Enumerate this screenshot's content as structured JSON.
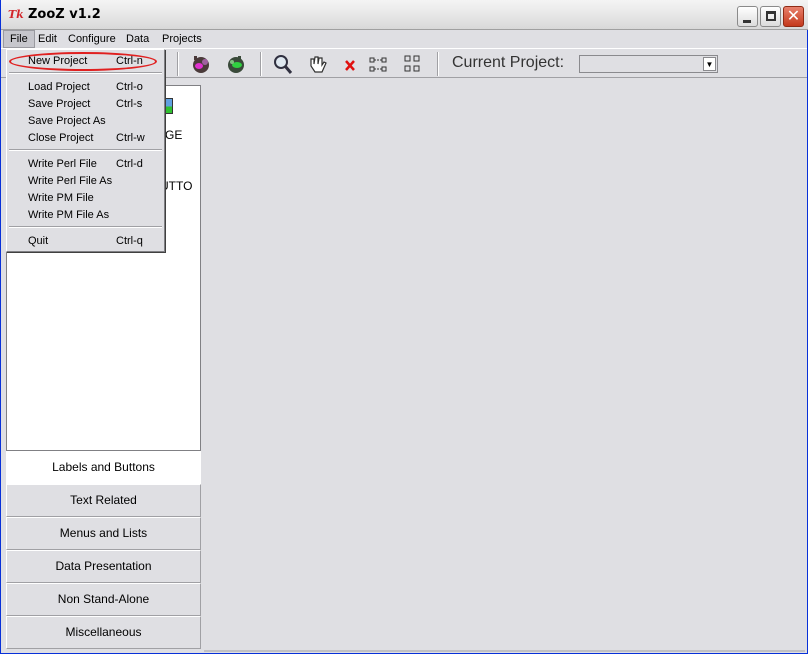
{
  "window": {
    "title": "ZooZ v1.2"
  },
  "menubar": {
    "items": [
      {
        "label": "File"
      },
      {
        "label": "Edit"
      },
      {
        "label": "Configure"
      },
      {
        "label": "Data"
      },
      {
        "label": "Projects"
      }
    ]
  },
  "toolbar": {
    "current_project_label": "Current Project:",
    "current_project_value": ""
  },
  "file_menu": {
    "items": [
      {
        "label": "New Project",
        "accel": "Ctrl-n"
      },
      {
        "label": "Load Project",
        "accel": "Ctrl-o"
      },
      {
        "label": "Save Project",
        "accel": "Ctrl-s"
      },
      {
        "label": "Save Project As",
        "accel": ""
      },
      {
        "label": "Close Project",
        "accel": "Ctrl-w"
      },
      {
        "label": "Write Perl File",
        "accel": "Ctrl-d"
      },
      {
        "label": "Write Perl File As",
        "accel": ""
      },
      {
        "label": "Write PM File",
        "accel": ""
      },
      {
        "label": "Write PM File As",
        "accel": ""
      },
      {
        "label": "Quit",
        "accel": "Ctrl-q"
      }
    ]
  },
  "widget_panel": {
    "visible_fragments": [
      "GE",
      "UTTO"
    ]
  },
  "categories": [
    {
      "label": "Labels and Buttons"
    },
    {
      "label": "Text Related"
    },
    {
      "label": "Menus and Lists"
    },
    {
      "label": "Data Presentation"
    },
    {
      "label": "Non Stand-Alone"
    },
    {
      "label": "Miscellaneous"
    }
  ],
  "icons": {
    "app": "tk-logo-icon",
    "toolbar": [
      "perl-script-icon",
      "perl-module-icon",
      "zoom-icon",
      "hand-icon",
      "delete-icon",
      "hierarchy-icon",
      "grid-icon"
    ]
  },
  "colors": {
    "highlight_ring": "#e02020",
    "window_bg": "#dfdfe3",
    "panel_bg": "#ffffff"
  }
}
